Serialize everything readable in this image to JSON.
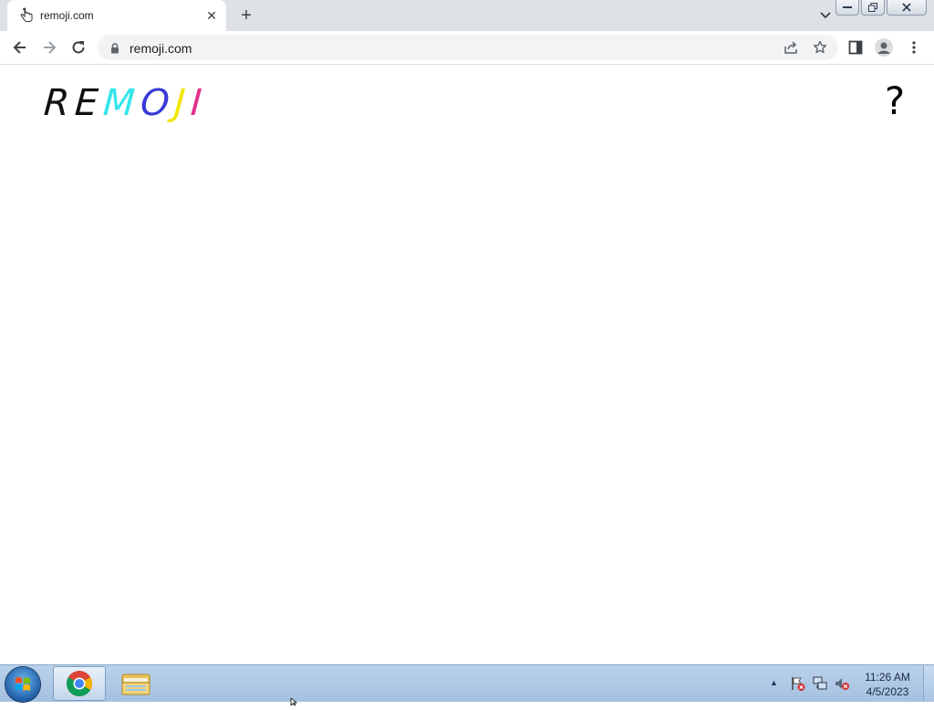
{
  "browser": {
    "tab": {
      "title": "remoji.com",
      "favicon": "hand-pointer-icon"
    },
    "address_bar": {
      "url": "remoji.com"
    }
  },
  "page": {
    "logo": {
      "letters": [
        "R",
        "E",
        "M",
        "O",
        "J",
        "I"
      ],
      "colors": [
        "#111111",
        "#111111",
        "#32e6ea",
        "#3a3ad6",
        "#f2e600",
        "#e0308a"
      ]
    },
    "help_label": "?"
  },
  "taskbar": {
    "clock": {
      "time": "11:26 AM",
      "date": "4/5/2023"
    }
  }
}
